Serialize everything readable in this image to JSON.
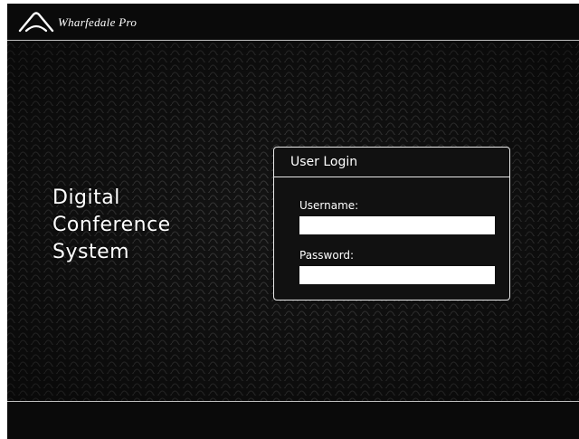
{
  "header": {
    "brand_name": "Wharfedale Pro",
    "logo_icon": "wharfedale-arc-logo"
  },
  "main": {
    "system_title_lines": [
      "Digital",
      "Conference",
      "System"
    ]
  },
  "login": {
    "title": "User Login",
    "username_label": "Username:",
    "username_value": "",
    "password_label": "Password:",
    "password_value": ""
  },
  "colors": {
    "background": "#0b0b0b",
    "text": "#ffffff",
    "panel_border": "#e8e8e8",
    "input_bg": "#ffffff"
  }
}
